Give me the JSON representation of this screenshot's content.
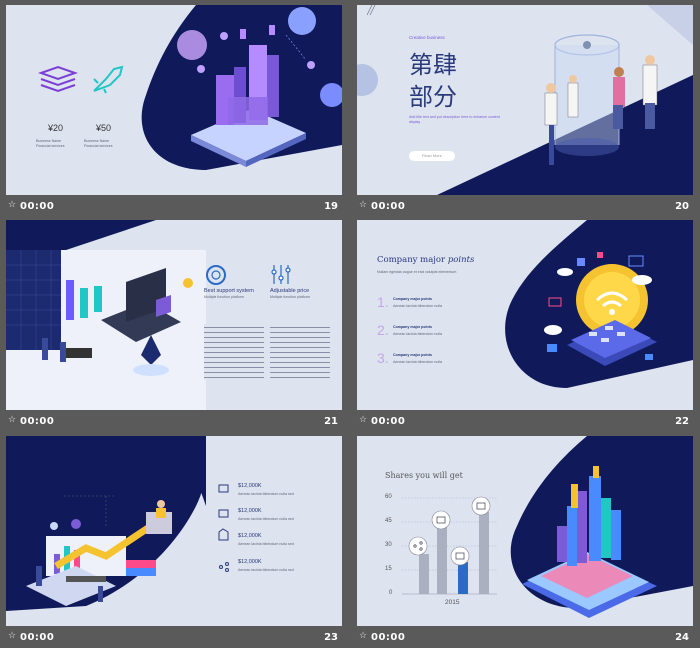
{
  "colors": {
    "navy": "#101a5a",
    "slide_bg": "#dde3ef",
    "purple": "#7b5cd6",
    "accent": "#a98ce0"
  },
  "thumbnails": [
    {
      "time": "00:00",
      "number": "19"
    },
    {
      "time": "00:00",
      "number": "20"
    },
    {
      "time": "00:00",
      "number": "21"
    },
    {
      "time": "00:00",
      "number": "22"
    },
    {
      "time": "00:00",
      "number": "23"
    },
    {
      "time": "00:00",
      "number": "24"
    }
  ],
  "s19": {
    "price1": "¥20",
    "price2": "¥50",
    "cap1": "Business Name",
    "cap1b": "Financial services",
    "cap2": "Business Name",
    "cap2b": "Financial services"
  },
  "s20": {
    "eyebrow": "Creative business",
    "title1": "第肆",
    "title2": "部分",
    "body": "Add title text and put description here to enhance content display",
    "btn": "Read More"
  },
  "s21": {
    "h1": "Best support system",
    "h2": "Adjustable price",
    "d1": "Multiple function platform",
    "d2": "Multiple function platform"
  },
  "s22": {
    "title": "Company major ",
    "title_em": "points",
    "sub": "Nullam egestas augue et erat volutpat elementum",
    "items": [
      {
        "n": "1.",
        "h": "Company major points",
        "d": "Aenean lacinia bibendum nulla"
      },
      {
        "n": "2.",
        "h": "Company major points",
        "d": "Aenean lacinia bibendum nulla"
      },
      {
        "n": "3.",
        "h": "Company major points",
        "d": "Aenean lacinia bibendum nulla"
      }
    ]
  },
  "s23": {
    "rows": [
      {
        "v": "$12,000K",
        "d": "Aenean lacinia bibendum nulla sed"
      },
      {
        "v": "$12,000K",
        "d": "Aenean lacinia bibendum nulla sed"
      },
      {
        "v": "$12,000K",
        "d": "Aenean lacinia bibendum nulla sed"
      },
      {
        "v": "$12,000K",
        "d": "Aenean lacinia bibendum nulla sed"
      }
    ]
  },
  "s24": {
    "title": "Shares you will get",
    "xlabel": "2015",
    "yticks": [
      "60",
      "45",
      "30",
      "15",
      "0"
    ]
  }
}
